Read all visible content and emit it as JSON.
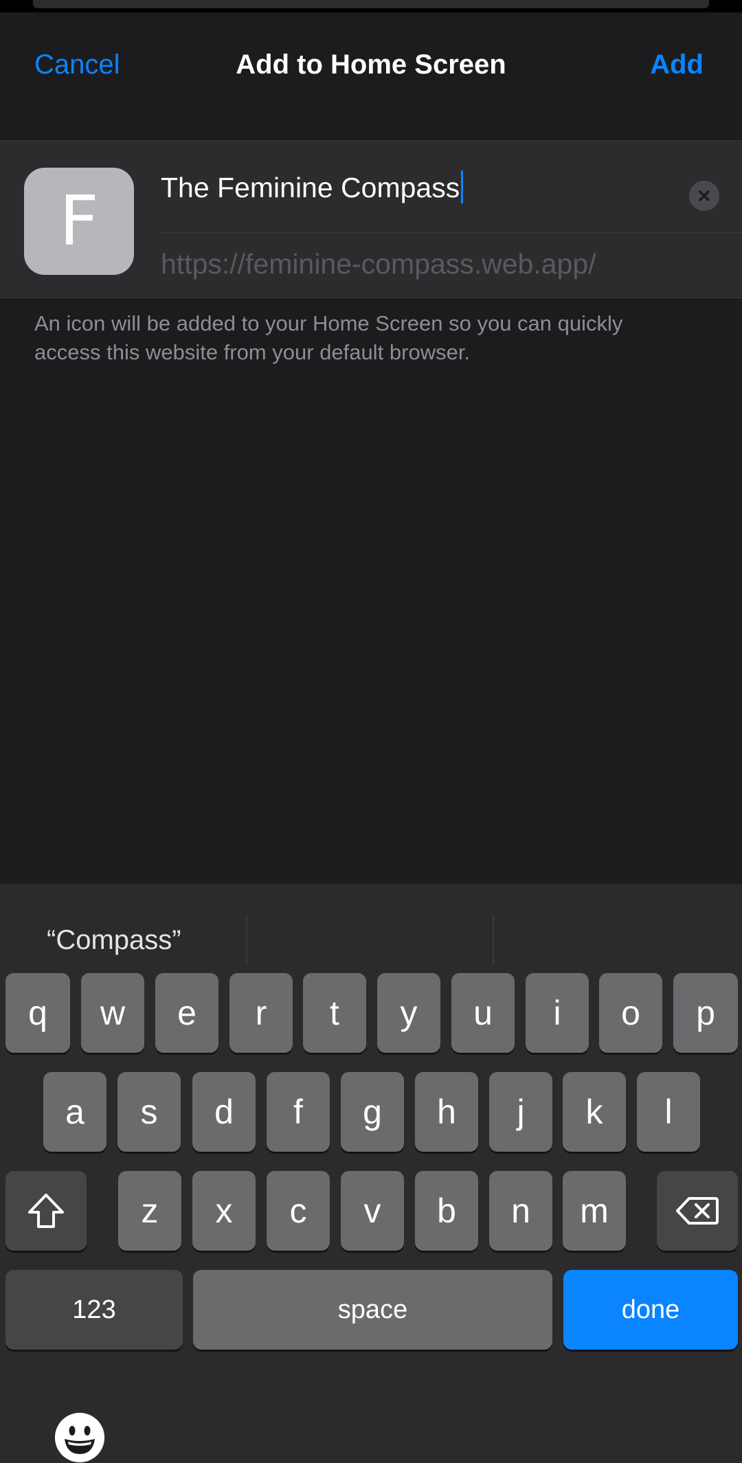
{
  "nav": {
    "cancel_label": "Cancel",
    "title": "Add to Home Screen",
    "add_label": "Add"
  },
  "app_icon": {
    "letter": "F",
    "background": "#b7b6bb"
  },
  "name_field": {
    "value": "The Feminine Compass"
  },
  "url_field": {
    "value": "https://feminine-compass.web.app/"
  },
  "footer_note": "An icon will be added to your Home Screen so you can quickly access this website from your default browser.",
  "keyboard": {
    "suggestions": [
      "“Compass”",
      "",
      ""
    ],
    "row1": [
      "q",
      "w",
      "e",
      "r",
      "t",
      "y",
      "u",
      "i",
      "o",
      "p"
    ],
    "row2": [
      "a",
      "s",
      "d",
      "f",
      "g",
      "h",
      "j",
      "k",
      "l"
    ],
    "row3": [
      "z",
      "x",
      "c",
      "v",
      "b",
      "n",
      "m"
    ],
    "numbers_label": "123",
    "space_label": "space",
    "done_label": "done",
    "icons": {
      "shift": "shift-icon",
      "backspace": "backspace-icon",
      "emoji": "emoji-icon"
    }
  },
  "colors": {
    "accent": "#0a84ff",
    "sheet_background": "#1c1c1e",
    "group_background": "#2c2c2e",
    "keyboard_background": "#2b2b2d"
  }
}
